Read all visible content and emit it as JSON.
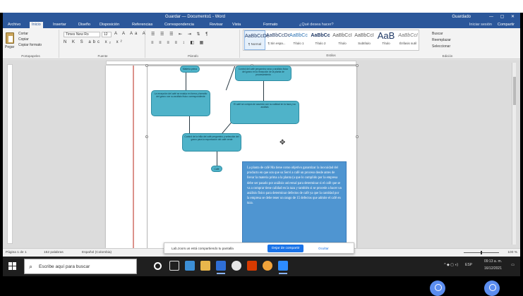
{
  "window": {
    "title": "Guardar — Documento1 - Word",
    "user": "Guardado",
    "controls": "— ▢ ✕"
  },
  "tabs": [
    "Archivo",
    "Inicio",
    "Insertar",
    "Diseño",
    "Disposición",
    "Referencias",
    "Correspondencia",
    "Revisar",
    "Vista",
    "Formato"
  ],
  "tell_me": "¿Qué desea hacer?",
  "account": "Iniciar sesión",
  "share": "Compartir",
  "ribbon": {
    "clipboard": {
      "paste": "Pegar",
      "cut": "Cortar",
      "copy": "Copiar",
      "painter": "Copiar formato",
      "label": "Portapapeles"
    },
    "font": {
      "name": "Times New Ro",
      "size": "12",
      "label": "Fuente",
      "format_row1": "A A Aa A",
      "format_row2": "N K S abc x₂ x²"
    },
    "paragraph": {
      "label": "Párrafo",
      "row1": "☰ ☰ ☰ ⇤ ⇥ ⇅ ¶",
      "row2": "≡ ≡ ≡ ≡ ↕ ◧ ▦"
    },
    "styles": {
      "label": "Estilos",
      "items": [
        {
          "big": "AaBbCcDc",
          "small": "¶ Normal"
        },
        {
          "big": "AaBbCcDc",
          "small": "¶ Sin espa..."
        },
        {
          "big": "AaBbCc",
          "small": "Título 1"
        },
        {
          "big": "AaBbCc",
          "small": "Título 2"
        },
        {
          "big": "AaBbCcI",
          "small": "Título"
        },
        {
          "big": "AaBbCcI",
          "small": "Subtítulo"
        },
        {
          "big": "AaB",
          "small": "Título"
        },
        {
          "big": "AaBbCcI",
          "small": "Énfasis sutil"
        }
      ]
    },
    "editing": {
      "find": "Buscar",
      "replace": "Reemplazar",
      "select": "Seleccionar",
      "label": "Edición"
    }
  },
  "document": {
    "paragraph": "La planta de café Ma tiene como objetivo garantizar la inocuidad del producto en que son que su Servi a café un proceso desde antes de llevar la materia prima a la planta (a que lo cumplido por la empresa debe ser pasado por análisis universal para determinar si el café que se va a comprar tiene calidad en la taza y también si se procede a hacer un análisis físico para determinar defectos de café ya que la cantidad por la empresa se debe tener un rango de 15 defectos que admite el café en taza.",
    "nodes": [
      "Materia prima",
      "Control del café pergamino seco y análisis físico del grano en la recepción de la planta de procesamiento",
      "La recepción del café se evalúa en forma y tamaño del grano con su análisis físico correspondiente",
      "El café se compra de acuerdo con su calidad en la taza y su análisis",
      "Control de la trilla del café pergamino y selección del grano para la exportación del café verde",
      "Café"
    ]
  },
  "statusbar": {
    "page": "Página 1 de 1",
    "words": "152 palabras",
    "lang": "Español (Colombia)",
    "zoom": "100 %"
  },
  "notification": {
    "message": "Lab.zoom.us está compartiendo tu pantalla",
    "stop": "Dejar de compartir",
    "hide": "Ocultar"
  },
  "taskbar": {
    "search_placeholder": "Escribe aquí para buscar",
    "time": "09:13 a. m.",
    "date": "16/12/2021",
    "lang": "ESP"
  },
  "colors": {
    "word_blue": "#2b579a",
    "node_fill": "#4fb3c9",
    "paragraph_box": "#4f95d1",
    "notif_button": "#1a73e8"
  }
}
